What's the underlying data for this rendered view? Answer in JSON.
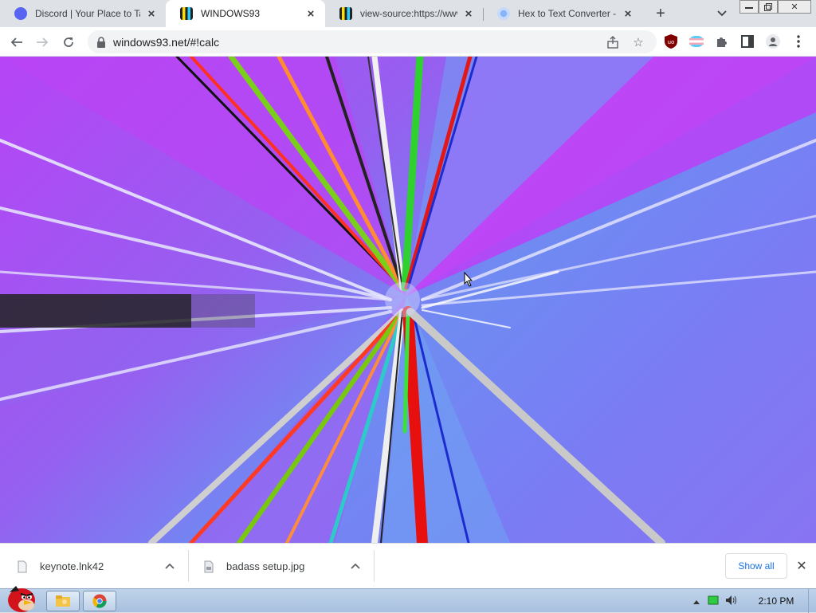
{
  "browser": {
    "tabs": [
      {
        "title": "Discord | Your Place to Talk",
        "favicon": "discord-icon",
        "active": false
      },
      {
        "title": "WINDOWS93",
        "favicon": "windows93-icon",
        "active": true
      },
      {
        "title": "view-source:https://www.",
        "favicon": "windows93-icon",
        "active": false
      },
      {
        "title": "Hex to Text Converter - Tr",
        "favicon": "hex-converter-icon",
        "active": false
      }
    ],
    "url": "windows93.net/#!calc",
    "extensions": [
      "ublock-origin-icon",
      "pride-flag-extension-icon",
      "puzzle-extensions-icon"
    ]
  },
  "downloads": [
    {
      "name": "keynote.lnk42",
      "icon": "file-icon"
    },
    {
      "name": "badass setup.jpg",
      "icon": "image-file-icon"
    }
  ],
  "download_shelf": {
    "show_all_label": "Show all"
  },
  "taskbar": {
    "start": "angry-bird-start-icon",
    "apps": [
      "file-explorer-icon",
      "chrome-icon"
    ],
    "clock": "2:10 PM"
  },
  "colors": {
    "content_magenta": "#b644f6",
    "content_violet": "#8874f2",
    "content_blue": "#6f8bf2",
    "link_blue": "#1a73e8"
  }
}
